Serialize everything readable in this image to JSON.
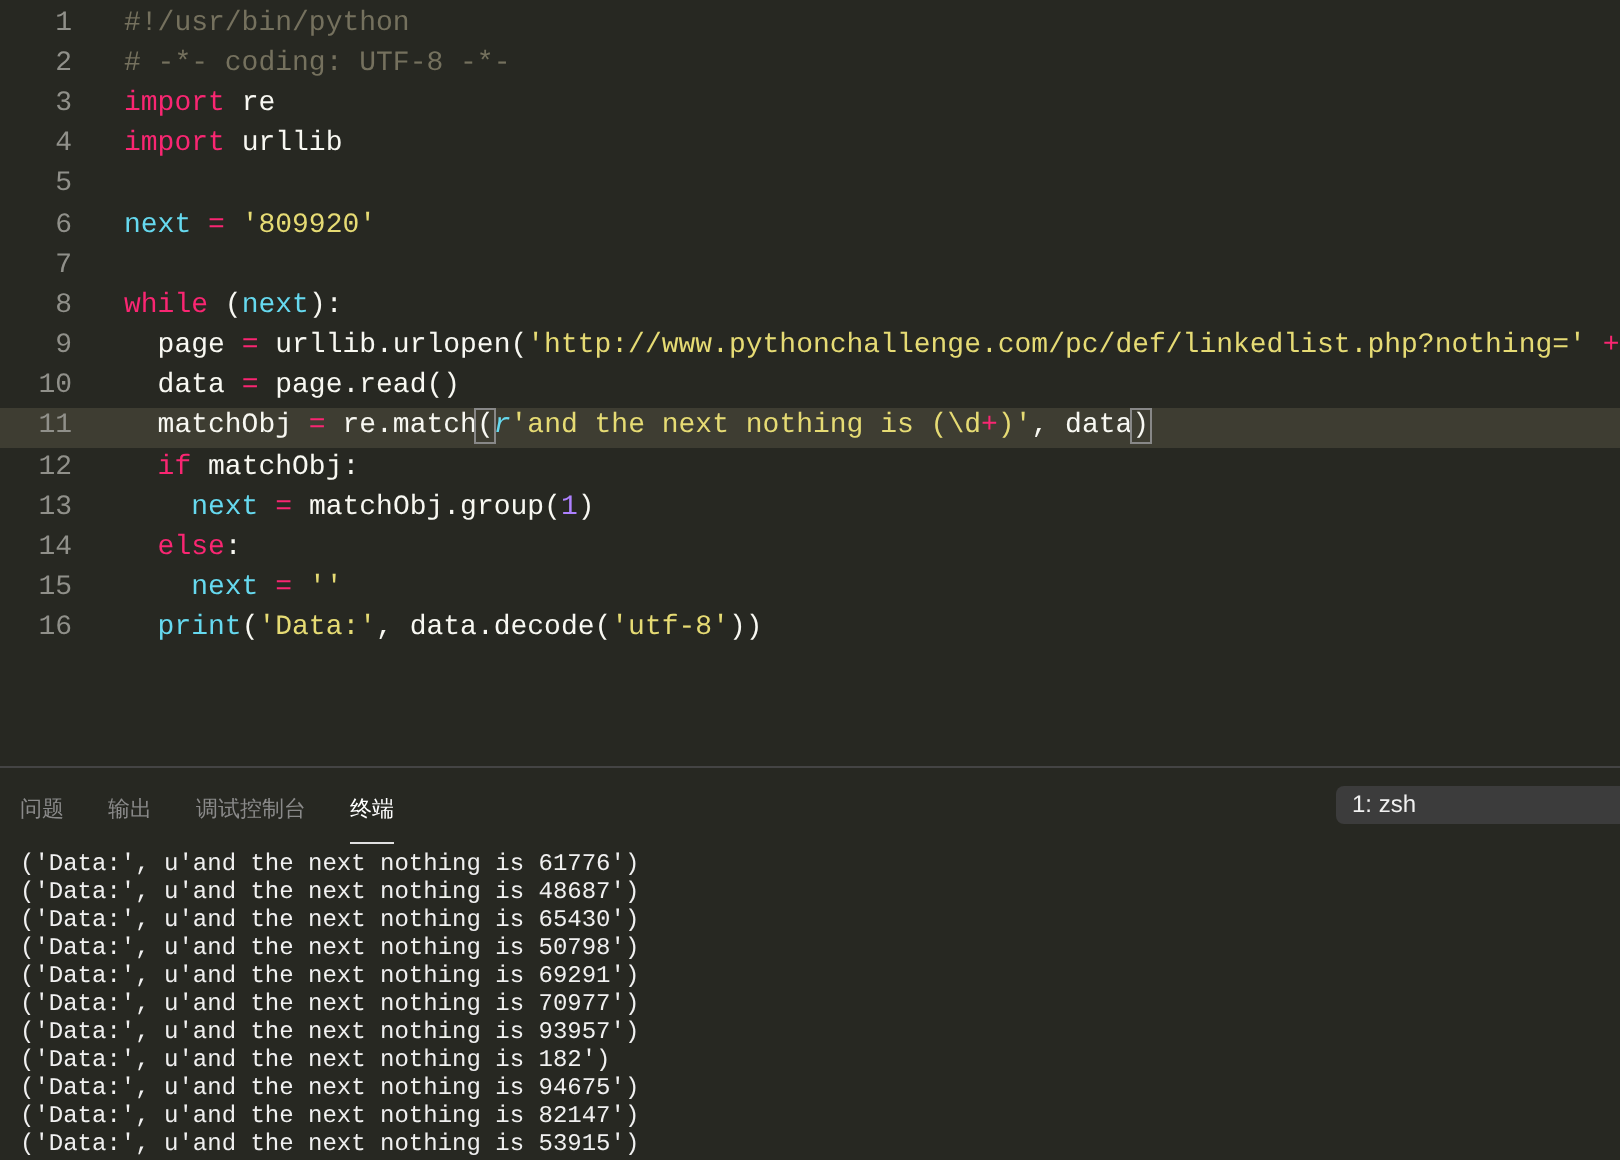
{
  "editor": {
    "lines": [
      {
        "number": "1",
        "current": false,
        "tokens": [
          {
            "kind": "comment",
            "text": "#!/usr/bin/python"
          }
        ]
      },
      {
        "number": "2",
        "current": false,
        "tokens": [
          {
            "kind": "comment",
            "text": "# -*- coding: UTF-8 -*-"
          }
        ]
      },
      {
        "number": "3",
        "current": false,
        "tokens": [
          {
            "kind": "keyword",
            "text": "import"
          },
          {
            "kind": "plain",
            "text": " re"
          }
        ]
      },
      {
        "number": "4",
        "current": false,
        "tokens": [
          {
            "kind": "keyword",
            "text": "import"
          },
          {
            "kind": "plain",
            "text": " urllib"
          }
        ]
      },
      {
        "number": "5",
        "current": false
      },
      {
        "number": "6",
        "current": false,
        "tokens": [
          {
            "kind": "name",
            "text": "next"
          },
          {
            "kind": "keyword",
            "text": " = "
          },
          {
            "kind": "string",
            "text": "'809920'"
          }
        ]
      },
      {
        "number": "7",
        "current": false
      },
      {
        "number": "8",
        "current": false,
        "tokens": [
          {
            "kind": "keyword",
            "text": "while"
          },
          {
            "kind": "plain",
            "text": " ("
          },
          {
            "kind": "name",
            "text": "next"
          },
          {
            "kind": "plain",
            "text": "):"
          }
        ]
      },
      {
        "number": "9",
        "current": false,
        "tokens": [
          {
            "kind": "plain",
            "text": "  page "
          },
          {
            "kind": "keyword",
            "text": "="
          },
          {
            "kind": "plain",
            "text": " urllib.urlopen("
          },
          {
            "kind": "string",
            "text": "'http://www.pythonchallenge.com/pc/def/linkedlist.php?nothing='"
          },
          {
            "kind": "keyword",
            "text": " +"
          }
        ]
      },
      {
        "number": "10",
        "current": false,
        "tokens": [
          {
            "kind": "plain",
            "text": "  data "
          },
          {
            "kind": "keyword",
            "text": "="
          },
          {
            "kind": "plain",
            "text": " page.read()"
          }
        ]
      },
      {
        "number": "11",
        "current": true,
        "tokens": [
          {
            "kind": "plain",
            "text": "  matchObj "
          },
          {
            "kind": "keyword",
            "text": "="
          },
          {
            "kind": "plain",
            "text": " re.match"
          },
          {
            "kind": "bracket",
            "text": "("
          },
          {
            "kind": "prefix",
            "text": "r"
          },
          {
            "kind": "string",
            "text": "'and the next nothing is (\\d"
          },
          {
            "kind": "keyword",
            "text": "+"
          },
          {
            "kind": "string",
            "text": ")'"
          },
          {
            "kind": "plain",
            "text": ", data"
          },
          {
            "kind": "bracket",
            "text": ")"
          }
        ]
      },
      {
        "number": "12",
        "current": false,
        "tokens": [
          {
            "kind": "keyword",
            "text": "  if"
          },
          {
            "kind": "plain",
            "text": " matchObj:"
          }
        ]
      },
      {
        "number": "13",
        "current": false,
        "tokens": [
          {
            "kind": "name",
            "text": "    next"
          },
          {
            "kind": "keyword",
            "text": " = "
          },
          {
            "kind": "plain",
            "text": "matchObj.group("
          },
          {
            "kind": "number",
            "text": "1"
          },
          {
            "kind": "plain",
            "text": ")"
          }
        ]
      },
      {
        "number": "14",
        "current": false,
        "tokens": [
          {
            "kind": "keyword",
            "text": "  else"
          },
          {
            "kind": "plain",
            "text": ":"
          }
        ]
      },
      {
        "number": "15",
        "current": false,
        "tokens": [
          {
            "kind": "name",
            "text": "    next"
          },
          {
            "kind": "keyword",
            "text": " = "
          },
          {
            "kind": "string",
            "text": "''"
          }
        ]
      },
      {
        "number": "16",
        "current": false,
        "tokens": [
          {
            "kind": "name",
            "text": "  print"
          },
          {
            "kind": "plain",
            "text": "("
          },
          {
            "kind": "string",
            "text": "'Data:'"
          },
          {
            "kind": "plain",
            "text": ", data.decode("
          },
          {
            "kind": "string",
            "text": "'utf-8'"
          },
          {
            "kind": "plain",
            "text": "))"
          }
        ]
      }
    ]
  },
  "panel": {
    "tabs": [
      {
        "label": "问题",
        "selected": false
      },
      {
        "label": "输出",
        "selected": false
      },
      {
        "label": "调试控制台",
        "selected": false
      },
      {
        "label": "终端",
        "selected": true
      }
    ],
    "terminal_selector": "1: zsh",
    "terminal_lines": [
      "('Data:', u'and the next nothing is 61776')",
      "('Data:', u'and the next nothing is 48687')",
      "('Data:', u'and the next nothing is 65430')",
      "('Data:', u'and the next nothing is 50798')",
      "('Data:', u'and the next nothing is 69291')",
      "('Data:', u'and the next nothing is 70977')",
      "('Data:', u'and the next nothing is 93957')",
      "('Data:', u'and the next nothing is 182')",
      "('Data:', u'and the next nothing is 94675')",
      "('Data:', u'and the next nothing is 82147')",
      "('Data:', u'and the next nothing is 53915')"
    ]
  }
}
